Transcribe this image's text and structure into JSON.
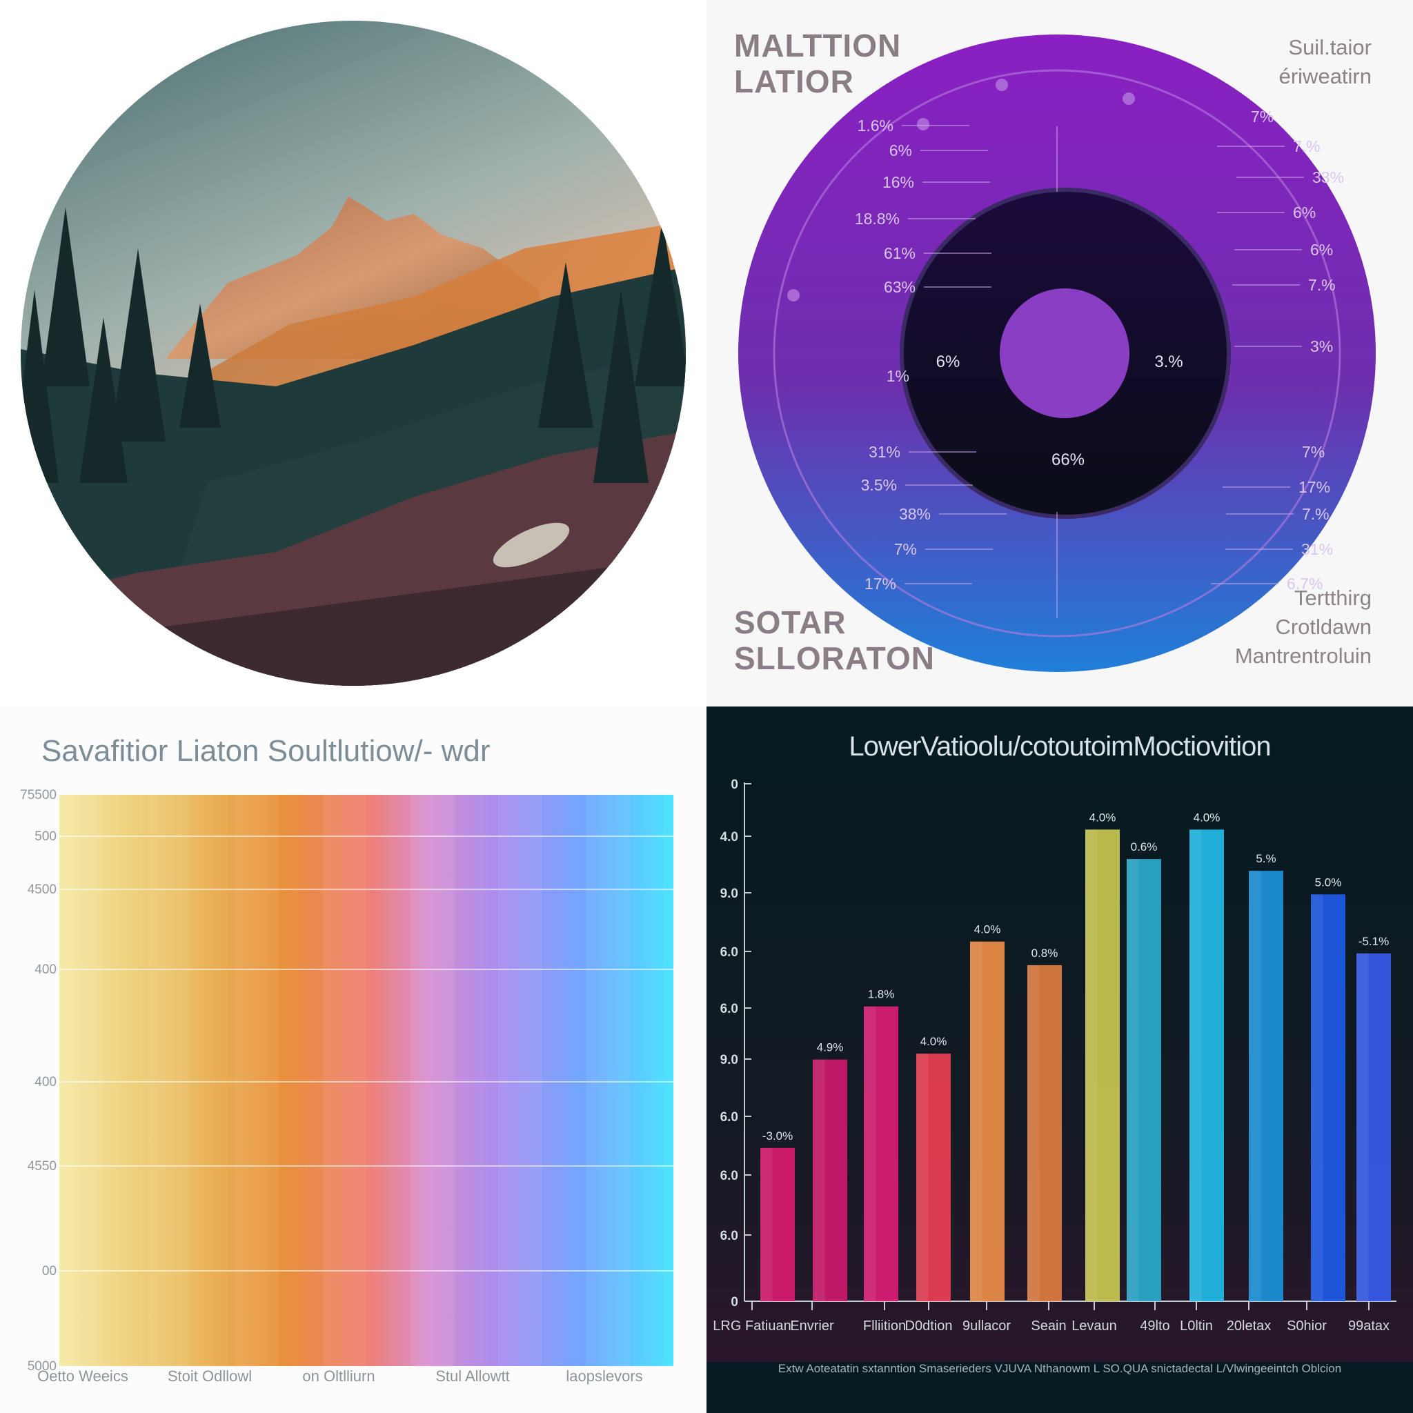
{
  "photo": {
    "subject": "mountain forest landscape at sunset in a circular frame",
    "colors": {
      "sky_top": "#3e6569",
      "sky_glow": "#e9c5b4",
      "peak": "#c98a63",
      "forest": "#1f3a3a",
      "foreground": "#5a3a40"
    }
  },
  "radial": {
    "title_lines": [
      "MALTTION",
      "LATIOR"
    ],
    "subtitle_lines": [
      "Suil.taior",
      "ériweatirn"
    ],
    "bottom_title_lines": [
      "SOTAR",
      "SLLORATON"
    ],
    "bottom_side_lines": [
      "Tertthirg",
      "Crotldawn",
      "Mantrentroluin"
    ],
    "left_labels": [
      "1.6%",
      "6%",
      "16%",
      "18.8%",
      "61%",
      "63%",
      "1%",
      "31%",
      "3.5%",
      "38%",
      "7%",
      "17%"
    ],
    "right_labels": [
      "7%",
      "7.%",
      "33%",
      "6%",
      "6%",
      "7.%",
      "3%",
      "7%",
      "17%",
      "7.%",
      "31%",
      "6.7%"
    ],
    "inner_labels": [
      "6%",
      "3.%",
      "66%"
    ],
    "colors": {
      "outer_top": "#8a1fc3",
      "outer_bottom": "#1f7fd8",
      "ring": "#0d0a1c",
      "center": "#8a3ec4"
    }
  },
  "chart_data": [
    {
      "type": "area",
      "title": "Savafitior Liaton Soultlutiow/- wdr",
      "y_tick_labels": [
        "75500",
        "500",
        "4500",
        "400",
        "400",
        "4550",
        "00",
        "5000"
      ],
      "x_tick_labels": [
        "Oetto Weeics",
        "Stoit Odllowl",
        "on Oltlliurn",
        "Stul Allowtt",
        "laopslevors"
      ],
      "gradient_colors": [
        "#f5e9a4",
        "#ebb85a",
        "#e88a3a",
        "#ef7f72",
        "#d88fd0",
        "#a78df0",
        "#6fa8ff",
        "#4ee4ff"
      ],
      "grid": true
    },
    {
      "type": "bar",
      "title": "LowerVatioolu/cotoutoimMoctiovition",
      "y_tick_labels": [
        "0",
        "4.0",
        "9.0",
        "6.0",
        "6.0",
        "9.0",
        "6.0",
        "6.0",
        "6.0",
        "0"
      ],
      "categories": [
        "LRG Fatiuan",
        "Envrier",
        "Flliition",
        "D0dtion",
        "9ullacor",
        "Seain",
        "Levaun",
        "49lto",
        "L0ltin",
        "20letax",
        "S0hior",
        "99atax"
      ],
      "data_labels": [
        "-3.0%",
        "4.9%",
        "1.8%",
        "4.0%",
        "4.0%",
        "0.8%",
        "4.0%",
        "0.6%",
        "4.0%",
        "5.%",
        "5.0%",
        "-5.1%"
      ],
      "values": [
        2.6,
        4.1,
        5.0,
        4.2,
        6.1,
        5.7,
        8.0,
        7.5,
        8.0,
        7.3,
        6.9,
        5.9
      ],
      "ylim": [
        0,
        8.8
      ],
      "bar_colors": [
        "#d41a6e",
        "#c8196c",
        "#d51e73",
        "#e53d52",
        "#e78a47",
        "#d9793f",
        "#c4c34f",
        "#2aa6c8",
        "#22b6e2",
        "#1c8fd6",
        "#1f58e3",
        "#3658e6"
      ],
      "footer": "Extw Aoteatatin sxtanntion Smaserieders  VJUVA Nthanowm L SO.QUA snictadectal L/Vlwingeeintch Oblcion"
    }
  ]
}
